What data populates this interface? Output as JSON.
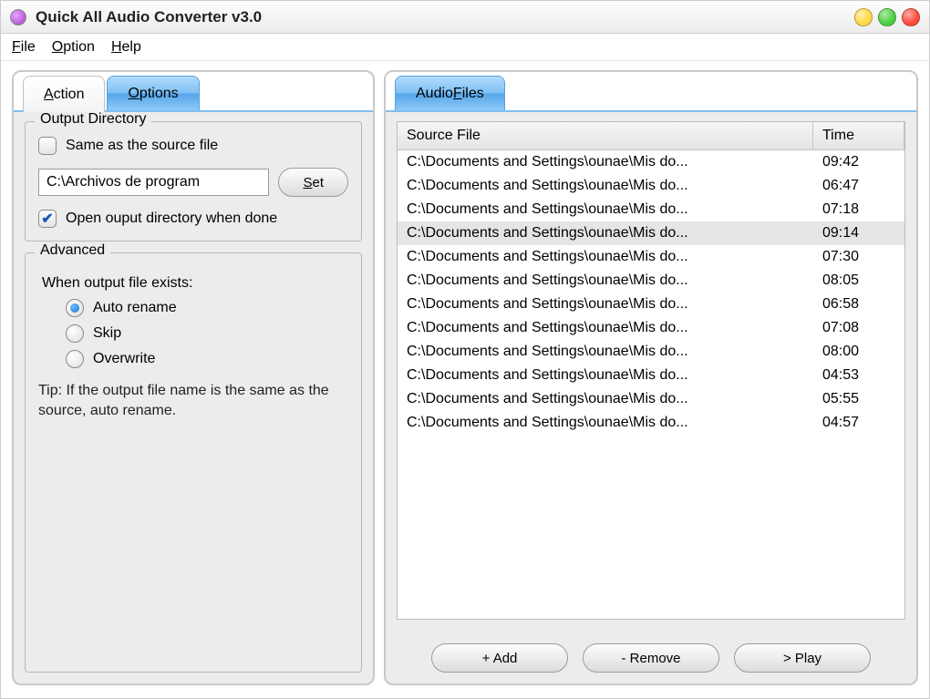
{
  "window": {
    "title": "Quick All Audio Converter v3.0"
  },
  "menu": {
    "file": "File",
    "option": "Option",
    "help": "Help"
  },
  "tabs": {
    "action": "Action",
    "options": "Options",
    "audio_files": "Audio Files"
  },
  "output_group": {
    "title": "Output Directory",
    "same_as_source": "Same as the source file",
    "path": "C:\\Archivos de program",
    "set_label": "Set",
    "open_when_done": "Open ouput directory when done"
  },
  "advanced": {
    "title": "Advanced",
    "when_exists": "When output file exists:",
    "auto_rename": "Auto rename",
    "skip": "Skip",
    "overwrite": "Overwrite",
    "tip": "Tip: If the output file name is the same as the source, auto rename."
  },
  "filelist": {
    "col_source": "Source File",
    "col_time": "Time",
    "rows": [
      {
        "src": "C:\\Documents and Settings\\ounae\\Mis do...",
        "time": "09:42"
      },
      {
        "src": "C:\\Documents and Settings\\ounae\\Mis do...",
        "time": "06:47"
      },
      {
        "src": "C:\\Documents and Settings\\ounae\\Mis do...",
        "time": "07:18"
      },
      {
        "src": "C:\\Documents and Settings\\ounae\\Mis do...",
        "time": "09:14"
      },
      {
        "src": "C:\\Documents and Settings\\ounae\\Mis do...",
        "time": "07:30"
      },
      {
        "src": "C:\\Documents and Settings\\ounae\\Mis do...",
        "time": "08:05"
      },
      {
        "src": "C:\\Documents and Settings\\ounae\\Mis do...",
        "time": "06:58"
      },
      {
        "src": "C:\\Documents and Settings\\ounae\\Mis do...",
        "time": "07:08"
      },
      {
        "src": "C:\\Documents and Settings\\ounae\\Mis do...",
        "time": "08:00"
      },
      {
        "src": "C:\\Documents and Settings\\ounae\\Mis do...",
        "time": "04:53"
      },
      {
        "src": "C:\\Documents and Settings\\ounae\\Mis do...",
        "time": "05:55"
      },
      {
        "src": "C:\\Documents and Settings\\ounae\\Mis do...",
        "time": "04:57"
      }
    ],
    "selected_index": 3
  },
  "buttons": {
    "add": "+ Add",
    "remove": "- Remove",
    "play": "> Play"
  }
}
